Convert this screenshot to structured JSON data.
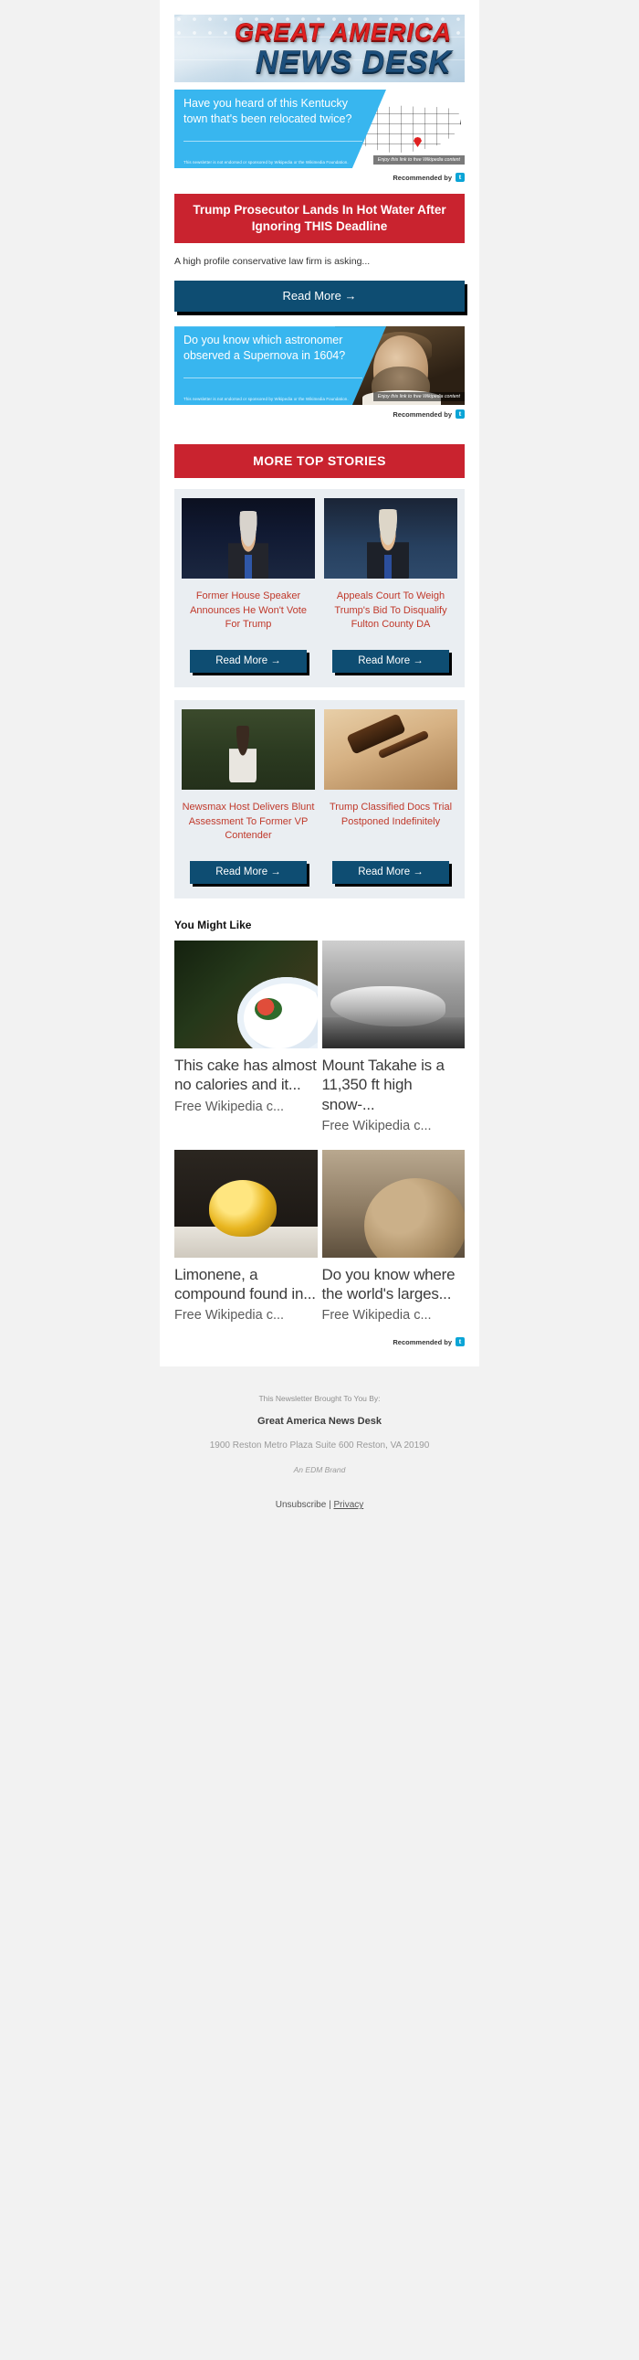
{
  "masthead": {
    "line1": "GREAT AMERICA",
    "line2": "NEWS DESK"
  },
  "ads": [
    {
      "headline": "Have you heard of this Kentucky town that's been relocated twice?",
      "disclaimer": "This newsletter is not endorsed or sponsored by Wikipedia or the Wikimedia Foundation.",
      "cta": "Enjoy this link to free Wikipedia content",
      "recommended_label": "Recommended by",
      "logo_glyph": "t"
    },
    {
      "headline": "Do you know which astronomer observed a Supernova in 1604?",
      "disclaimer": "This newsletter is not endorsed or sponsored by Wikipedia or the Wikimedia Foundation.",
      "cta": "Enjoy this link to free Wikipedia content",
      "recommended_label": "Recommended by",
      "logo_glyph": "t"
    }
  ],
  "lead_story": {
    "headline": "Trump Prosecutor Lands In Hot Water After Ignoring THIS Deadline",
    "teaser": "A high profile conservative law firm is asking...",
    "button_label": "Read More →"
  },
  "more_top_stories": {
    "section_label": "MORE TOP STORIES",
    "stories": [
      {
        "title": "Former House Speaker Announces He Won't Vote For Trump",
        "button_label": "Read More →",
        "image": "trump-at-podium"
      },
      {
        "title": "Appeals Court To Weigh Trump's Bid To Disqualify Fulton County DA",
        "button_label": "Read More →",
        "image": "trump-speaking"
      },
      {
        "title": "Newsmax Host Delivers Blunt Assessment To Former VP Contender",
        "button_label": "Read More →",
        "image": "woman-outdoors"
      },
      {
        "title": "Trump Classified Docs Trial Postponed Indefinitely",
        "button_label": "Read More →",
        "image": "judge-gavel"
      }
    ]
  },
  "you_might_like": {
    "title": "You Might Like",
    "recommended_label": "Recommended by",
    "logo_glyph": "t",
    "cards": [
      {
        "title": "This cake has almost no calories and it...",
        "source": "Free Wikipedia c...",
        "image": "cake-on-plate"
      },
      {
        "title": "Mount Takahe is a 11,350 ft high snow-...",
        "source": "Free Wikipedia c...",
        "image": "mount-takahe"
      },
      {
        "title": "Limonene, a compound found in...",
        "source": "Free Wikipedia c...",
        "image": "limonene-liquid"
      },
      {
        "title": "Do you know where the world's larges...",
        "source": "Free Wikipedia c...",
        "image": "large-sphere"
      }
    ]
  },
  "footer": {
    "brought_by": "This Newsletter Brought To You By:",
    "brand": "Great America News Desk",
    "address": "1900 Reston Metro Plaza Suite 600 Reston, VA 20190",
    "edm": "An EDM Brand",
    "unsubscribe": "Unsubscribe",
    "separator": " | ",
    "privacy": "Privacy"
  },
  "colors": {
    "red": "#c9232f",
    "blue_button": "#0e4d72",
    "ad_blue": "#38b6ef",
    "title_red": "#c0392b",
    "page_bg": "#f2f2f2"
  }
}
